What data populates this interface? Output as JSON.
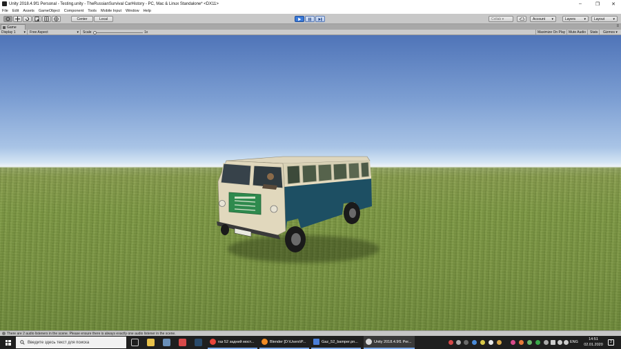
{
  "window": {
    "title": "Unity 2018.4.9f1 Personal - Testing.unity - TheRussianSurvival CarHistory - PC, Mac & Linux Standalone* <DX11>",
    "controls": [
      "–",
      "❐",
      "✕"
    ]
  },
  "menu": [
    "File",
    "Edit",
    "Assets",
    "GameObject",
    "Component",
    "Tools",
    "Mobile Input",
    "Window",
    "Help"
  ],
  "toolbar": {
    "pivot_label": "Center",
    "space_label": "Local",
    "collab_label": "Collab ▾",
    "account_label": "Account",
    "layers_label": "Layers",
    "layout_label": "Layout"
  },
  "game_tab": {
    "label": "Game"
  },
  "game_bar": {
    "display": "Display 1",
    "aspect": "Free Aspect",
    "scale_label": "Scale",
    "scale_value": "1x",
    "maximize": "Maximize On Play",
    "mute": "Mute Audio",
    "stats": "Stats",
    "gizmos": "Gizmos ▾"
  },
  "status": {
    "message": "There are 2 audio listeners in the scene. Please ensure there is always exactly one audio listener in the scene."
  },
  "taskbar": {
    "search_placeholder": "Введите здесь текст для поиска",
    "apps": [
      {
        "label": "газ 52 задний мост...",
        "color": "#e8453c"
      },
      {
        "label": "Blender [D:\\Users\\P...",
        "color": "#f08a24"
      },
      {
        "label": "Gaz_52_bamper.pn...",
        "color": "#4a7ed8"
      },
      {
        "label": "Unity 2018.4.9f1 Per...",
        "color": "#d8d8d8"
      }
    ],
    "lang": "ENG",
    "time": "14:51",
    "date": "02.01.2020",
    "notifications": "2"
  },
  "colors": {
    "play_accent": "#3b7ad8",
    "bus_blue": "#1d4f63",
    "bus_cream": "#e6dcc0",
    "grille_green": "#2f8a4e"
  }
}
